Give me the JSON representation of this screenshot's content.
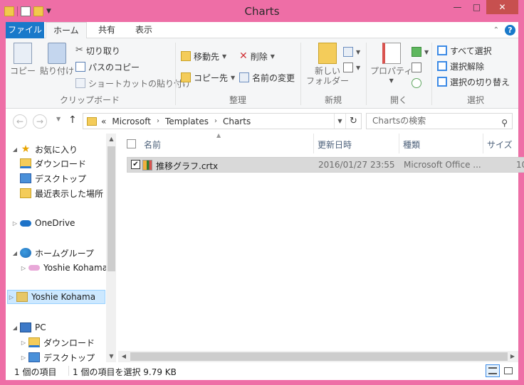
{
  "window": {
    "title": "Charts",
    "controls": {
      "minimize": "—",
      "maximize": "□",
      "close": "✕"
    }
  },
  "ribbon": {
    "tabs": [
      "ファイル",
      "ホーム",
      "共有",
      "表示"
    ],
    "groups": {
      "clipboard": {
        "label": "クリップボード",
        "copy": "コピー",
        "paste": "貼り付け",
        "cut": "切り取り",
        "copy_path": "パスのコピー",
        "paste_shortcut": "ショートカットの貼り付け"
      },
      "organize": {
        "label": "整理",
        "move_to": "移動先",
        "copy_to": "コピー先",
        "delete": "削除",
        "rename": "名前の変更"
      },
      "new": {
        "label": "新規",
        "new_folder_line1": "新しい",
        "new_folder_line2": "フォルダー"
      },
      "open": {
        "label": "開く",
        "properties": "プロパティ"
      },
      "select": {
        "label": "選択",
        "select_all": "すべて選択",
        "select_none": "選択解除",
        "invert": "選択の切り替え"
      }
    }
  },
  "address": {
    "overflow": "«",
    "crumbs": [
      "Microsoft",
      "Templates",
      "Charts"
    ],
    "search_placeholder": "Chartsの検索"
  },
  "navpane": {
    "favorites": "お気に入り",
    "downloads": "ダウンロード",
    "desktop": "デスクトップ",
    "recent": "最近表示した場所",
    "onedrive": "OneDrive",
    "homegroup": "ホームグループ",
    "homegroup_user": "Yoshie Kohama",
    "user_folder": "Yoshie Kohama",
    "pc": "PC",
    "pc_downloads": "ダウンロード",
    "pc_desktop": "デスクトップ"
  },
  "filelist": {
    "columns": {
      "name": "名前",
      "modified": "更新日時",
      "type": "種類",
      "size": "サイズ"
    },
    "files": [
      {
        "name": "推移グラフ.crtx",
        "modified": "2016/01/27 23:55",
        "type": "Microsoft Office ...",
        "size": "10",
        "checked": true
      }
    ]
  },
  "status": {
    "count": "1 個の項目",
    "selection": "1 個の項目を選択  9.79 KB"
  },
  "colors": {
    "frame": "#ee6ea6",
    "file_tab": "#1979ca",
    "selection": "#cce8ff"
  }
}
